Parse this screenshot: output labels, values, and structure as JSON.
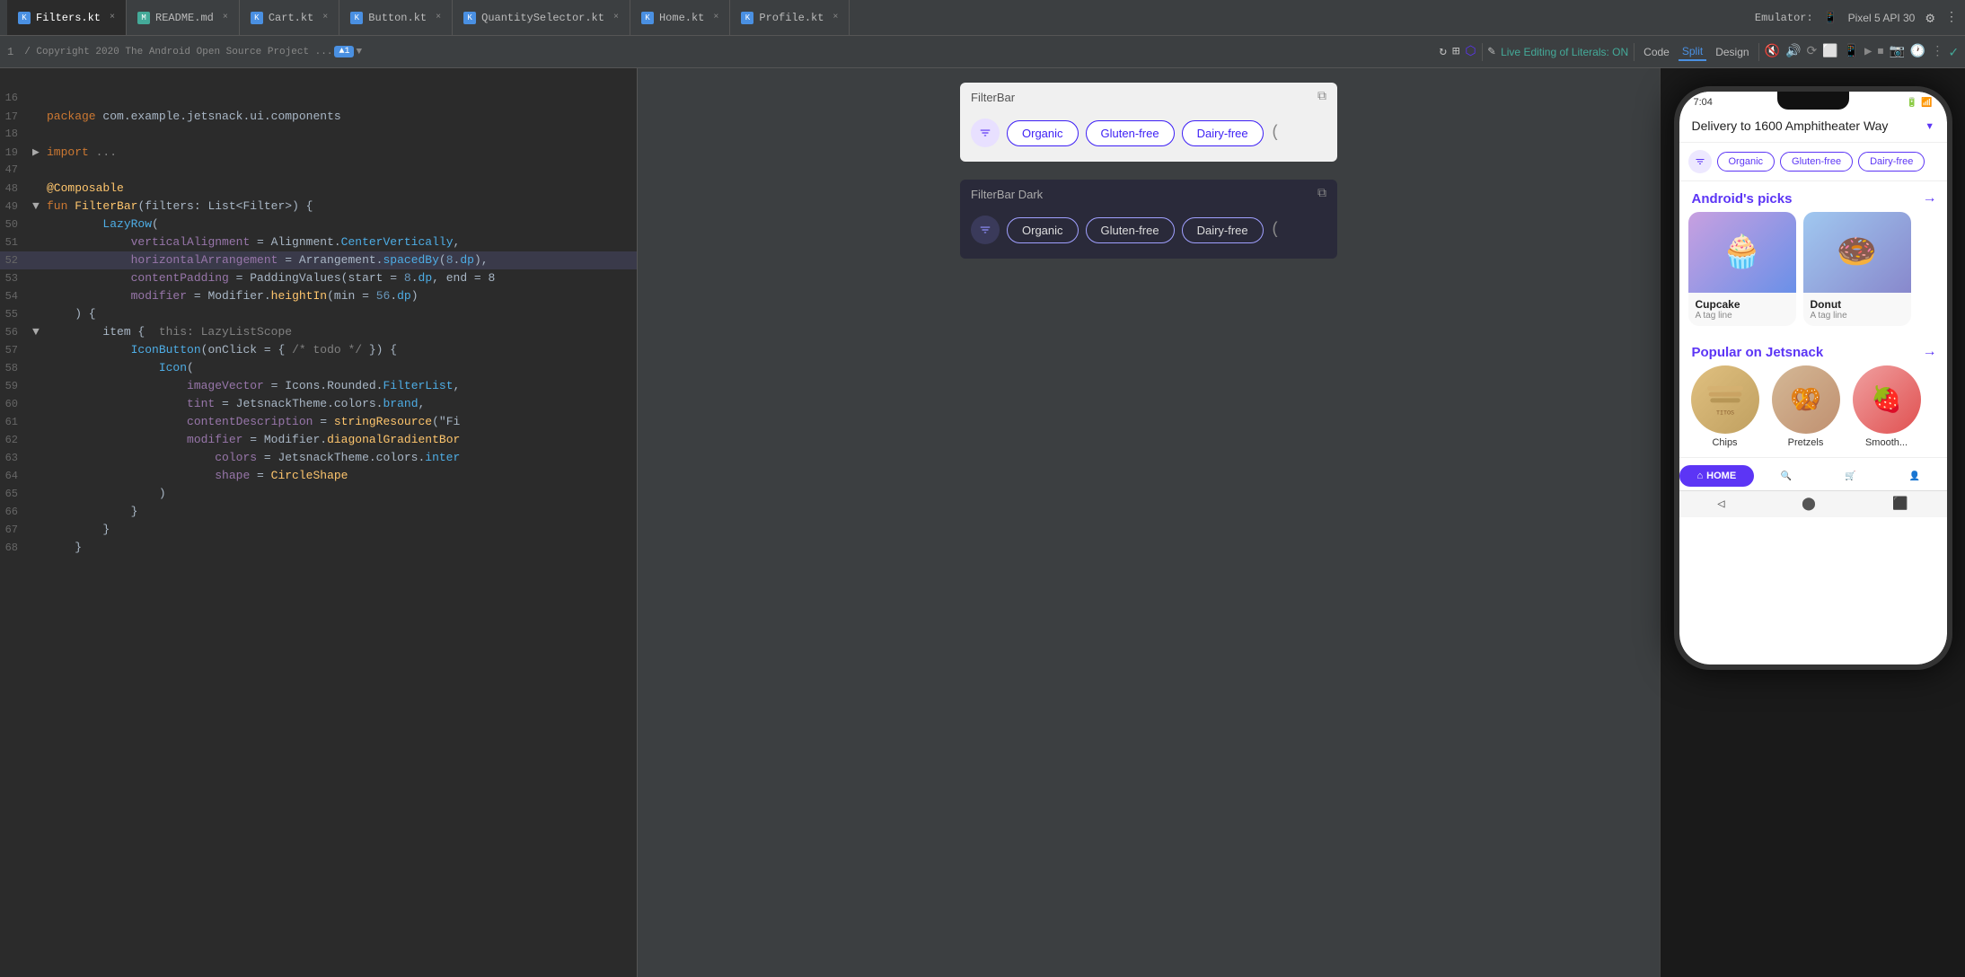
{
  "tabs": [
    {
      "label": "README.md",
      "active": false,
      "icon_color": "#4a9",
      "icon_char": "M"
    },
    {
      "label": "Filters.kt",
      "active": true,
      "icon_color": "#4a90e2",
      "icon_char": "K"
    },
    {
      "label": "Cart.kt",
      "active": false,
      "icon_color": "#4a90e2",
      "icon_char": "K"
    },
    {
      "label": "Button.kt",
      "active": false,
      "icon_color": "#4a90e2",
      "icon_char": "K"
    },
    {
      "label": "QuantitySelector.kt",
      "active": false,
      "icon_color": "#4a90e2",
      "icon_char": "K"
    },
    {
      "label": "Home.kt",
      "active": false,
      "icon_color": "#4a90e2",
      "icon_char": "K"
    },
    {
      "label": "Profile.kt",
      "active": false,
      "icon_color": "#4a90e2",
      "icon_char": "K"
    }
  ],
  "emulator": {
    "label": "Emulator:",
    "device": "Pixel 5 API 30"
  },
  "toolbar": {
    "live_editing": "Live Editing of Literals: ON",
    "code_btn": "Code",
    "split_btn": "Split",
    "design_btn": "Design"
  },
  "code_lines": [
    {
      "num": "",
      "text": "",
      "fold": false,
      "highlight": false
    },
    {
      "num": "16",
      "text": "",
      "fold": false,
      "highlight": false
    },
    {
      "num": "17",
      "text": "package com.example.jetsnack.ui.components",
      "fold": false,
      "highlight": false
    },
    {
      "num": "18",
      "text": "",
      "fold": false,
      "highlight": false
    },
    {
      "num": "19",
      "text": "import ...",
      "fold": true,
      "highlight": false
    },
    {
      "num": "47",
      "text": "",
      "fold": false,
      "highlight": false
    },
    {
      "num": "48",
      "text": "@Composable",
      "fold": false,
      "highlight": false
    },
    {
      "num": "49",
      "text": "fun FilterBar(filters: List<Filter>) {",
      "fold": true,
      "highlight": false
    },
    {
      "num": "50",
      "text": "    LazyRow(",
      "fold": false,
      "highlight": false
    },
    {
      "num": "51",
      "text": "        verticalAlignment = Alignment.CenterVertically,",
      "fold": false,
      "highlight": false
    },
    {
      "num": "52",
      "text": "        horizontalArrangement = Arrangement.spacedBy(8.dp),",
      "fold": false,
      "highlight": true
    },
    {
      "num": "53",
      "text": "        contentPadding = PaddingValues(start = 8.dp, end = 8",
      "fold": false,
      "highlight": false
    },
    {
      "num": "54",
      "text": "        modifier = Modifier.heightIn(min = 56.dp)",
      "fold": false,
      "highlight": false
    },
    {
      "num": "55",
      "text": "    ) {",
      "fold": false,
      "highlight": false
    },
    {
      "num": "56",
      "text": "        item {  this: LazyListScope",
      "fold": false,
      "highlight": false
    },
    {
      "num": "57",
      "text": "            IconButton(onClick = { /* todo */ }) {",
      "fold": false,
      "highlight": false
    },
    {
      "num": "58",
      "text": "                Icon(",
      "fold": false,
      "highlight": false
    },
    {
      "num": "59",
      "text": "                    imageVector = Icons.Rounded.FilterList,",
      "fold": false,
      "highlight": false
    },
    {
      "num": "60",
      "text": "                    tint = JetsnackTheme.colors.brand,",
      "fold": false,
      "highlight": false
    },
    {
      "num": "61",
      "text": "                    contentDescription = stringResource(\"Fi",
      "fold": false,
      "highlight": false
    },
    {
      "num": "62",
      "text": "                    modifier = Modifier.diagonalGradientBor",
      "fold": false,
      "highlight": false
    },
    {
      "num": "63",
      "text": "                        colors = JetsnackTheme.colors.inter",
      "fold": false,
      "highlight": false
    },
    {
      "num": "64",
      "text": "                        shape = CircleShape",
      "fold": false,
      "highlight": false
    },
    {
      "num": "65",
      "text": "                )",
      "fold": false,
      "highlight": false
    },
    {
      "num": "66",
      "text": "            }",
      "fold": false,
      "highlight": false
    },
    {
      "num": "67",
      "text": "        }",
      "fold": false,
      "highlight": false
    },
    {
      "num": "68",
      "text": "    }",
      "fold": false,
      "highlight": false
    }
  ],
  "preview_light": {
    "title": "FilterBar",
    "chips": [
      "Organic",
      "Gluten-free",
      "Dairy-free"
    ]
  },
  "preview_dark": {
    "title": "FilterBar Dark",
    "chips": [
      "Organic",
      "Gluten-free",
      "Dairy-free"
    ]
  },
  "phone": {
    "time": "7:04",
    "delivery": "Delivery to 1600 Amphitheater Way",
    "filters": [
      "Organic",
      "Gluten-free",
      "Dairy-free"
    ],
    "androids_picks": {
      "title": "Android's picks",
      "items": [
        {
          "name": "Cupcake",
          "tag": "A tag line",
          "emoji": "🧁"
        },
        {
          "name": "Donut",
          "tag": "A tag line",
          "emoji": "🍩"
        }
      ]
    },
    "popular": {
      "title": "Popular on Jetsnack",
      "items": [
        {
          "name": "Chips",
          "emoji": "🥔"
        },
        {
          "name": "Pretzels",
          "emoji": "🥨"
        },
        {
          "name": "Smooth...",
          "emoji": "🍓"
        }
      ]
    },
    "nav": {
      "home": "HOME",
      "items": [
        "search",
        "cart",
        "profile"
      ]
    }
  }
}
